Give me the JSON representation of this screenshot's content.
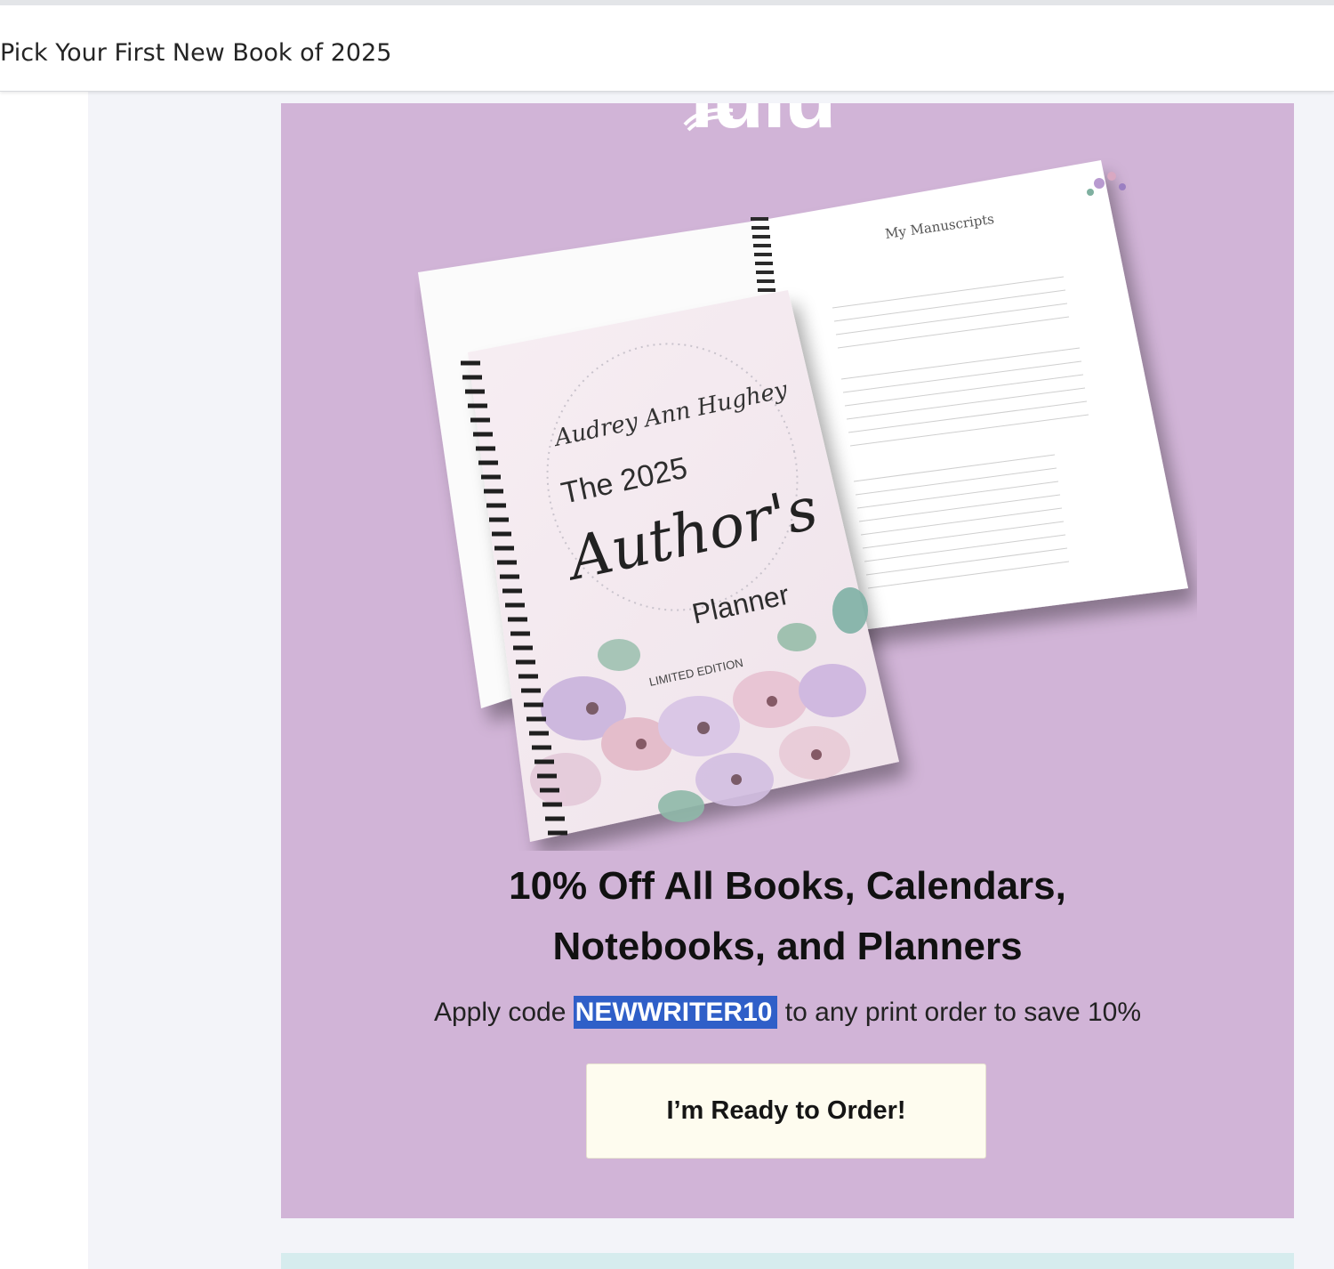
{
  "email": {
    "subject": "Pick Your First New Book of 2025"
  },
  "promo": {
    "logo_text": "lulu",
    "product": {
      "author_signature": "Audrey Ann Hughey",
      "cover_title_line1": "The 2025",
      "cover_title_script": "Author's",
      "cover_title_line3": "Planner",
      "cover_edition": "LIMITED EDITION",
      "page_heading": "My Manuscripts"
    },
    "headline_line1": "10% Off All Books, Calendars,",
    "headline_line2": "Notebooks, and Planners",
    "code_prefix": "Apply code ",
    "code": "NEWWRITER10",
    "code_suffix": " to any print order to save 10%",
    "cta_label": "I’m Ready to Order!"
  },
  "colors": {
    "promo_background": "#d1b4d7",
    "email_background": "#f3f4f9",
    "cta_background": "#fefcef",
    "selection_highlight": "#2f5fc8"
  }
}
